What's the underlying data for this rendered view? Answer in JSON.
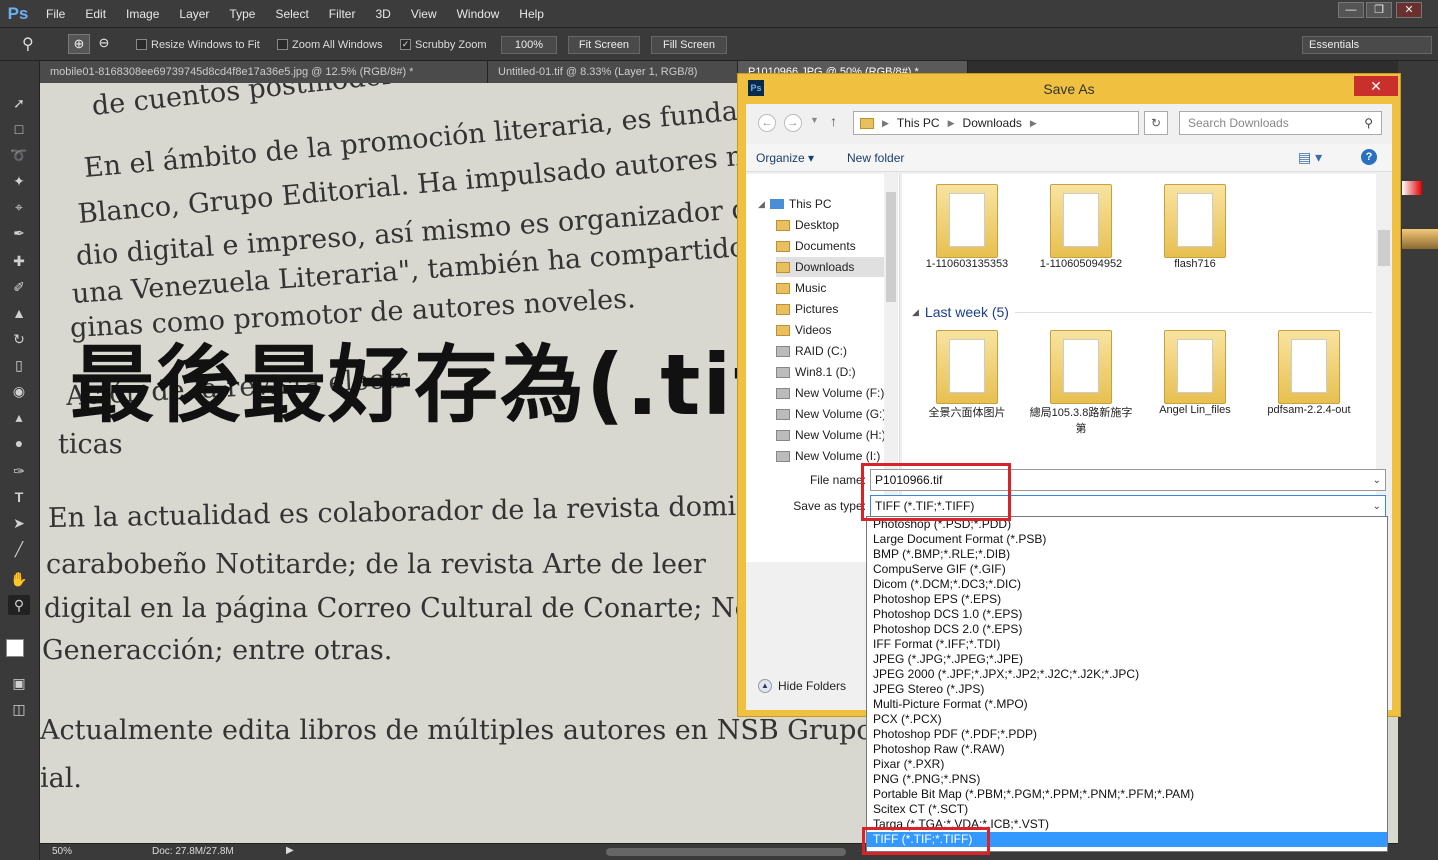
{
  "app": {
    "logo": "Ps"
  },
  "menu": [
    "File",
    "Edit",
    "Image",
    "Layer",
    "Type",
    "Select",
    "Filter",
    "3D",
    "View",
    "Window",
    "Help"
  ],
  "window_controls": [
    "—",
    "❐",
    "✕"
  ],
  "options_bar": {
    "resize_windows": "Resize Windows to Fit",
    "zoom_all": "Zoom All Windows",
    "scrubby_zoom": "Scrubby Zoom",
    "zoom_value": "100%",
    "fit_screen": "Fit Screen",
    "fill_screen": "Fill Screen",
    "workspace": "Essentials"
  },
  "doc_tabs": [
    "mobile01-8168308ee69739745d8cd4f8e17a36e5.jpg @ 12.5% (RGB/8#) *",
    "Untitled-01.tif @ 8.33% (Layer 1, RGB/8)",
    "P1010966.JPG @ 50% (RGB/8#) *"
  ],
  "page_lines": [
    "de cuentos postmoder",
    "En el ámbito de la promoción literaria, es fundador",
    "Blanco, Grupo Editorial. Ha impulsado autores nov",
    "dio digital e impreso, así mismo es organizador de",
    "una Venezuela Literaria\", también ha compartidos",
    "ginas como promotor de autores noveles.",
    "Ac        ón de la revista electr",
    "ticas",
    "En la actualidad es colaborador de la revista domi",
    "carabobeño  Notitarde; de la revista Arte de leer",
    "digital en la página Correo Cultural de Conarte; Ne",
    "Generacción; entre otras.",
    "Actualmente edita libros de múltiples autores en NSB Grupo",
    "ial."
  ],
  "overlay_text": "最後最好存為(.tif)更為好",
  "status": {
    "zoom": "50%",
    "doc": "Doc: 27.8M/27.8M"
  },
  "dialog": {
    "title": "Save As",
    "close": "✕",
    "ps_icon": "Ps",
    "address": [
      "This PC",
      "Downloads"
    ],
    "search_placeholder": "Search Downloads",
    "organize": "Organize",
    "new_folder": "New folder",
    "nav_items": [
      "This PC",
      "Desktop",
      "Documents",
      "Downloads",
      "Music",
      "Pictures",
      "Videos",
      "RAID (C:)",
      "Win8.1 (D:)",
      "New Volume (F:)",
      "New Volume (G:)",
      "New Volume (H:)",
      "New Volume (I:)"
    ],
    "folders_top": [
      "1-110603135353",
      "1-110605094952",
      "flash716"
    ],
    "group_header": "Last week (5)",
    "folders_week": [
      "全景六面体图片",
      "總局105.3.8路新施字第",
      "Angel Lin_files",
      "pdfsam-2.2.4-out"
    ],
    "file_name_label": "File name:",
    "file_name_value": "P1010966.tif",
    "save_type_label": "Save as type:",
    "save_type_value": "TIFF (*.TIF;*.TIFF)",
    "hide_folders": "Hide Folders"
  },
  "type_options": [
    "Photoshop (*.PSD;*.PDD)",
    "Large Document Format (*.PSB)",
    "BMP (*.BMP;*.RLE;*.DIB)",
    "CompuServe GIF (*.GIF)",
    "Dicom (*.DCM;*.DC3;*.DIC)",
    "Photoshop EPS (*.EPS)",
    "Photoshop DCS 1.0 (*.EPS)",
    "Photoshop DCS 2.0 (*.EPS)",
    "IFF Format (*.IFF;*.TDI)",
    "JPEG (*.JPG;*.JPEG;*.JPE)",
    "JPEG 2000 (*.JPF;*.JPX;*.JP2;*.J2C;*.J2K;*.JPC)",
    "JPEG Stereo (*.JPS)",
    "Multi-Picture Format (*.MPO)",
    "PCX (*.PCX)",
    "Photoshop PDF (*.PDF;*.PDP)",
    "Photoshop Raw (*.RAW)",
    "Pixar (*.PXR)",
    "PNG (*.PNG;*.PNS)",
    "Portable Bit Map (*.PBM;*.PGM;*.PPM;*.PNM;*.PFM;*.PAM)",
    "Scitex CT (*.SCT)",
    "Targa (*.TGA;*.VDA;*.ICB;*.VST)",
    "TIFF (*.TIF;*.TIFF)"
  ],
  "colors": {
    "highlight": "#3399ff",
    "annotation": "#d8232a",
    "dialog_frame": "#f0c040"
  }
}
